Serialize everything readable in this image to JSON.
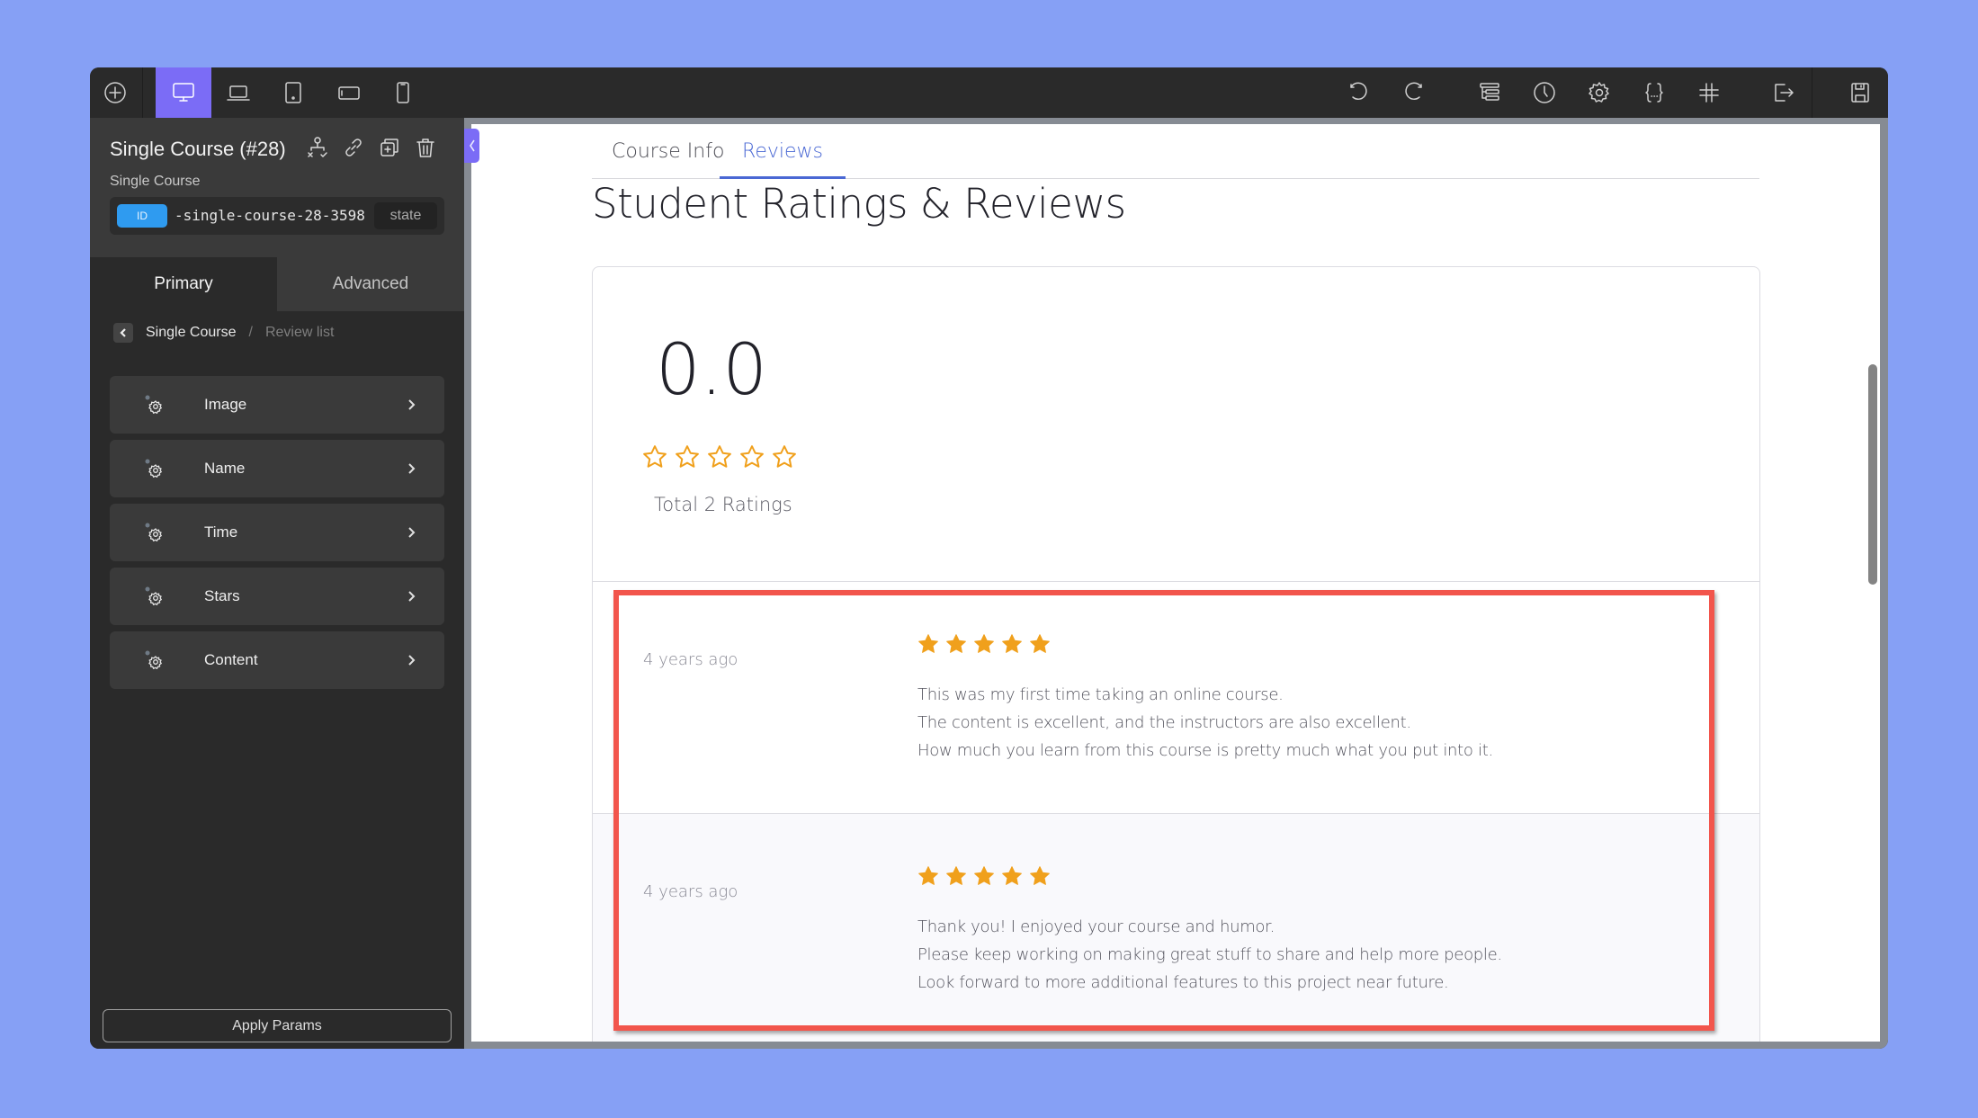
{
  "toolbar": {
    "left_icons": [
      {
        "name": "add-icon",
        "label": "Add element"
      },
      {
        "name": "desktop-icon",
        "label": "Desktop",
        "active": true
      },
      {
        "name": "laptop-icon",
        "label": "Laptop"
      },
      {
        "name": "tablet-icon",
        "label": "Tablet"
      },
      {
        "name": "mobile-landscape-icon",
        "label": "Mobile landscape"
      },
      {
        "name": "mobile-portrait-icon",
        "label": "Mobile portrait"
      }
    ],
    "right_icons": [
      {
        "name": "undo-icon"
      },
      {
        "name": "redo-icon"
      },
      {
        "name": "structure-icon"
      },
      {
        "name": "history-icon"
      },
      {
        "name": "settings-icon"
      },
      {
        "name": "code-icon"
      },
      {
        "name": "grid-icon"
      },
      {
        "name": "exit-icon"
      },
      {
        "name": "save-icon"
      }
    ]
  },
  "sidebar": {
    "title": "Single Course (#28)",
    "subtitle": "Single Course",
    "id_badge": "ID",
    "id_value": "-single-course-28-3598",
    "state_label": "state",
    "tabs": [
      {
        "label": "Primary",
        "active": true
      },
      {
        "label": "Advanced",
        "active": false
      }
    ],
    "breadcrumb": {
      "parent": "Single Course",
      "separator": "/",
      "current": "Review list"
    },
    "items": [
      {
        "label": "Image"
      },
      {
        "label": "Name"
      },
      {
        "label": "Time"
      },
      {
        "label": "Stars"
      },
      {
        "label": "Content"
      }
    ],
    "apply_label": "Apply Params"
  },
  "page": {
    "tabs": [
      {
        "label": "Course Info",
        "active": false
      },
      {
        "label": "Reviews",
        "active": true
      }
    ],
    "heading": "Student Ratings & Reviews",
    "summary": {
      "average": "0.0",
      "stars_filled": 0,
      "stars_total": 5,
      "total_text": "Total 2 Ratings"
    },
    "reviews": [
      {
        "time": "4 years ago",
        "stars": 5,
        "lines": [
          "This was my first time taking an online course.",
          "The content is excellent, and the instructors are also excellent.",
          "How much you learn from this course is pretty much what you put into it."
        ]
      },
      {
        "time": "4 years ago",
        "stars": 5,
        "lines": [
          "Thank you! I enjoyed your course and humor.",
          "Please keep working on making great stuff to share and help more people.",
          "Look forward to more additional features to this project near future."
        ]
      }
    ]
  },
  "colors": {
    "accent": "#7b6cf6",
    "tab_active": "#4a68d4",
    "star": "#f0a01c",
    "highlight": "#f2554c",
    "background": "#86a0f5"
  }
}
